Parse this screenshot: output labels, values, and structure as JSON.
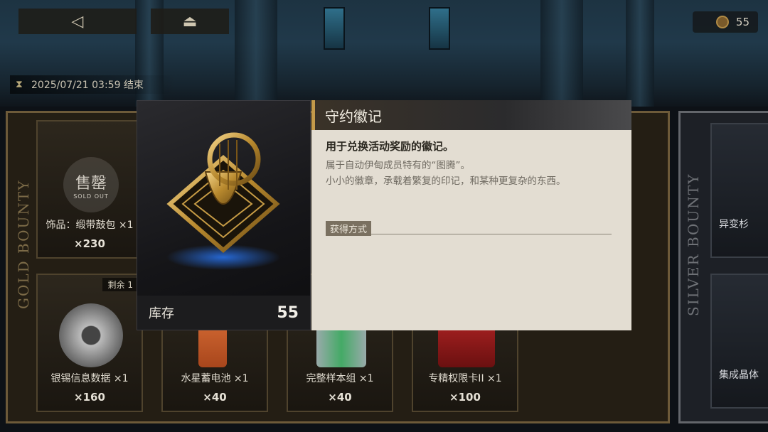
{
  "header": {
    "back_icon": "back-arrow-icon",
    "home_icon": "home-icon",
    "currency_value": "55",
    "event_end_time": "2025/07/21 03:59 结束"
  },
  "gold_shop": {
    "panel_label": "GOLD BOUNTY",
    "sold_out_text": "售罄",
    "sold_out_sub": "SOLD OUT",
    "top_item_name": "饰品：缎带鼓包 ×1",
    "top_item_price": "×230",
    "items": [
      {
        "name": "银锡信息数据 ×1",
        "price": "×160",
        "remain": "剩余  1"
      },
      {
        "name": "水星蓄电池 ×1",
        "price": "×40"
      },
      {
        "name": "完整样本组 ×1",
        "price": "×40"
      },
      {
        "name": "专精权限卡II ×1",
        "price": "×100"
      }
    ]
  },
  "silver_shop": {
    "panel_label": "SILVER BOUNTY",
    "items": [
      {
        "name": "异变杉"
      },
      {
        "name": "集成晶体"
      }
    ]
  },
  "item_detail": {
    "title": "守约徽记",
    "description_main": "用于兑换活动奖励的徽记。",
    "description_lines": [
      "属于自动伊甸成员特有的“图腾”。",
      "小小的徽章，承载着繁复的印记，和某种更复杂的东西。"
    ],
    "obtain_label": "获得方式",
    "stock_label": "库存",
    "stock_value": "55"
  },
  "colors": {
    "accent_gold": "#c49a4a",
    "panel_bg": "#e3ddd2",
    "dark_bg": "#0d1116"
  }
}
